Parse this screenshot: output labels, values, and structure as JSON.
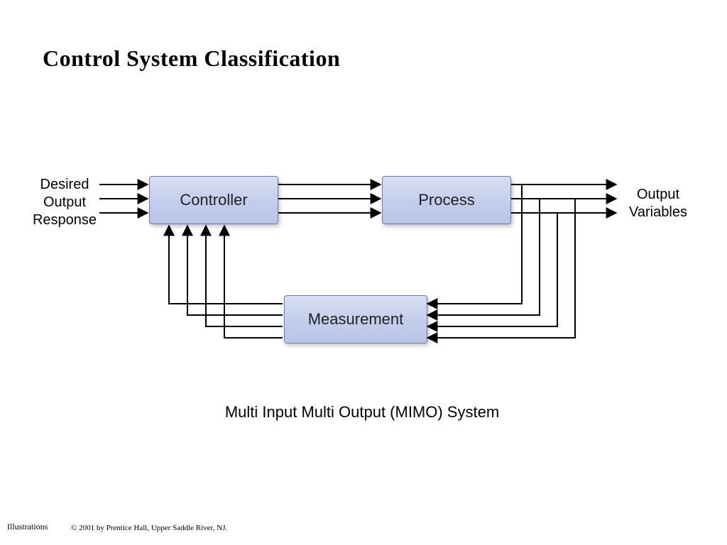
{
  "title": "Control  System Classification",
  "labels": {
    "input": "Desired\nOutput\nResponse",
    "output": "Output\nVariables"
  },
  "blocks": {
    "controller": "Controller",
    "process": "Process",
    "measurement": "Measurement"
  },
  "caption": "Multi Input Multi Output (MIMO) System",
  "footer": {
    "left": "Illustrations",
    "copyright": "© 2001 by Prentice Hall, Upper Saddle River, NJ."
  },
  "diagram": {
    "type": "closed-loop-mimo",
    "nodes": [
      {
        "id": "controller",
        "label": "Controller"
      },
      {
        "id": "process",
        "label": "Process"
      },
      {
        "id": "measurement",
        "label": "Measurement"
      }
    ],
    "edges": [
      {
        "from": "input",
        "to": "controller",
        "count": 3
      },
      {
        "from": "controller",
        "to": "process",
        "count": 3
      },
      {
        "from": "process",
        "to": "output",
        "count": 3
      },
      {
        "from": "output-tap",
        "to": "measurement",
        "count": 4
      },
      {
        "from": "measurement",
        "to": "controller",
        "count": 4
      }
    ]
  }
}
